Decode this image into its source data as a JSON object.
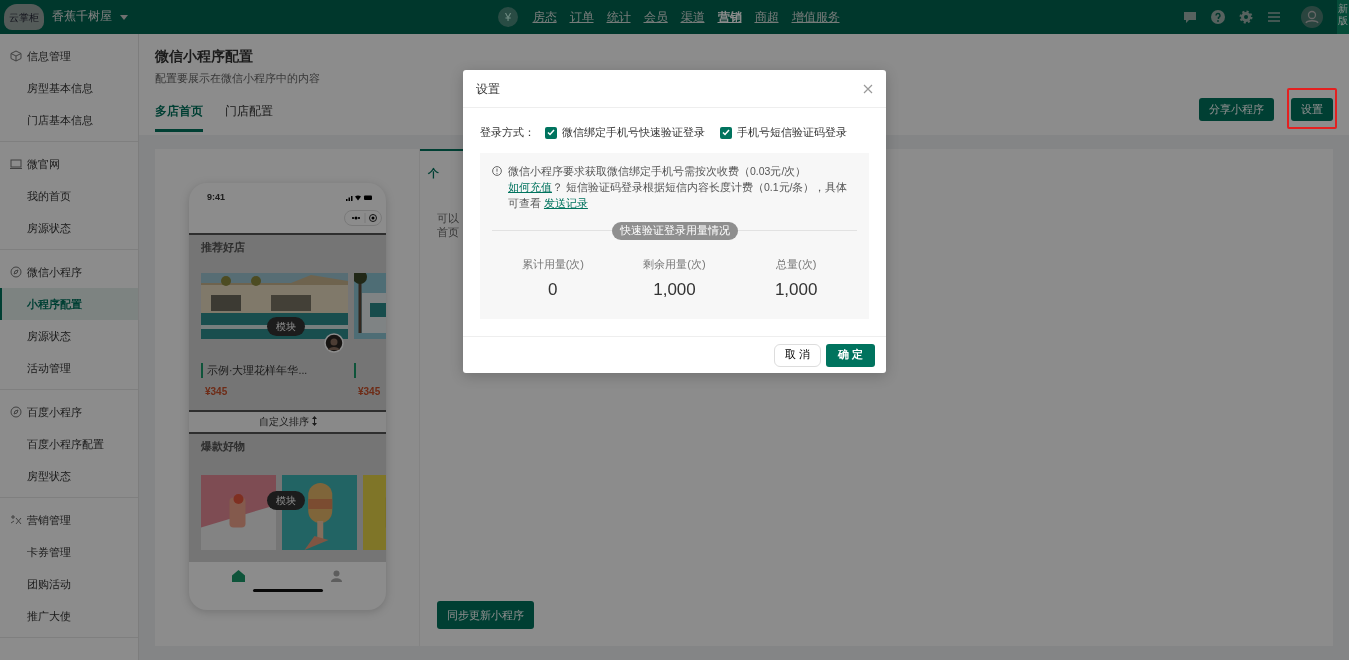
{
  "topbar": {
    "logo": "云掌柜",
    "store": "香蕉千树屋",
    "currency": "¥",
    "nav": [
      {
        "label": "房态",
        "selected": false
      },
      {
        "label": "订单",
        "selected": false
      },
      {
        "label": "统计",
        "selected": false
      },
      {
        "label": "会员",
        "selected": false
      },
      {
        "label": "渠道",
        "selected": false
      },
      {
        "label": "营销",
        "selected": true
      },
      {
        "label": "商超",
        "selected": false
      },
      {
        "label": "增值服务",
        "selected": false
      }
    ],
    "new_version_tab": "新版"
  },
  "sidebar": {
    "groups": [
      {
        "title": "信息管理",
        "items": [
          {
            "label": "房型基本信息",
            "selected": false
          },
          {
            "label": "门店基本信息",
            "selected": false
          }
        ]
      },
      {
        "title": "微官网",
        "items": [
          {
            "label": "我的首页",
            "selected": false
          },
          {
            "label": "房源状态",
            "selected": false
          }
        ]
      },
      {
        "title": "微信小程序",
        "items": [
          {
            "label": "小程序配置",
            "selected": true
          },
          {
            "label": "房源状态",
            "selected": false
          },
          {
            "label": "活动管理",
            "selected": false
          }
        ]
      },
      {
        "title": "百度小程序",
        "items": [
          {
            "label": "百度小程序配置",
            "selected": false
          },
          {
            "label": "房型状态",
            "selected": false
          }
        ]
      },
      {
        "title": "营销管理",
        "items": [
          {
            "label": "卡券管理",
            "selected": false
          },
          {
            "label": "团购活动",
            "selected": false
          },
          {
            "label": "推广大使",
            "selected": false
          }
        ]
      }
    ]
  },
  "page": {
    "title": "微信小程序配置",
    "subtitle": "配置要展示在微信小程序中的内容",
    "tabs": [
      {
        "label": "多店首页",
        "selected": true
      },
      {
        "label": "门店配置",
        "selected": false
      }
    ],
    "buttons": [
      {
        "label": "分享小程序",
        "highlighted": false
      },
      {
        "label": "设置",
        "highlighted": true
      }
    ]
  },
  "phone": {
    "time": "9:41",
    "shops": {
      "title": "推荐好店",
      "module_label": "模块",
      "cards": [
        {
          "name": "示例·大理花样年华...",
          "price": "¥345"
        },
        {
          "price": "¥345"
        }
      ]
    },
    "sort_bar": "自定义排序",
    "goods": {
      "title": "爆款好物",
      "module_label": "模块"
    },
    "tabbar": [
      {
        "selected": true
      },
      {
        "selected": false
      }
    ]
  },
  "panel": {
    "tab": "个",
    "lines": [
      "可以",
      "首页"
    ],
    "sync_button": "同步更新小程序"
  },
  "dialog": {
    "title": "设置",
    "login_label": "登录方式：",
    "options": [
      {
        "label": "微信绑定手机号快速验证登录",
        "checked": true
      },
      {
        "label": "手机号短信验证码登录",
        "checked": true
      }
    ],
    "notice": "微信小程序要求获取微信绑定手机号需按次收费（0.03元/次）",
    "notice_link": "如何充值",
    "notice_2": "？ 短信验证码登录根据短信内容长度计费（0.1元/条），具体可查看",
    "notice_link_2": "发送记录",
    "usage_title": "快速验证登录用量情况",
    "stats": [
      {
        "label": "累计用量(次)",
        "value": "0"
      },
      {
        "label": "剩余用量(次)",
        "value": "1,000"
      },
      {
        "label": "总量(次)",
        "value": "1,000"
      }
    ],
    "cancel": "取 消",
    "ok": "确 定"
  }
}
